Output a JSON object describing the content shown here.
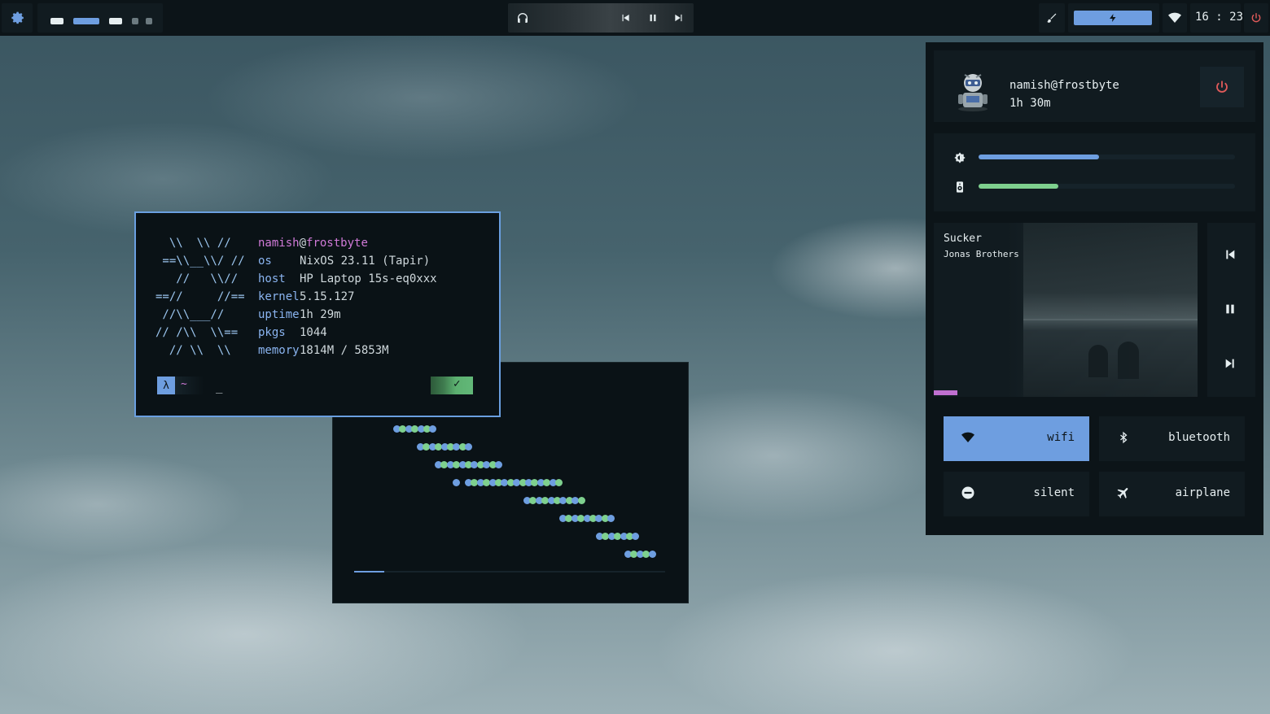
{
  "topbar": {
    "settings_icon": "gear-icon",
    "workspaces": [
      {
        "color": "#e6eef0",
        "active": false
      },
      {
        "color": "#6e9ee0",
        "active": true
      },
      {
        "color": "#e6eef0",
        "active": false
      },
      {
        "color": "#6c7a80",
        "active": false
      },
      {
        "color": "#6c7a80",
        "active": false
      }
    ],
    "media_icons": [
      "headphones-icon",
      "skip-previous-icon",
      "pause-icon",
      "skip-next-icon"
    ],
    "brush_icon": "brush-icon",
    "battery_icon": "lightning-icon",
    "wifi_icon": "wifi-icon",
    "clock": "16 : 23",
    "power_icon": "power-icon",
    "accent_color": "#6e9ee0",
    "danger_color": "#e05a5a"
  },
  "fetch": {
    "ascii_logo": "  \\\\  \\\\ //\n ==\\\\__\\\\/ //\n   //   \\\\//\n==//     //==\n //\\\\___//\n// /\\\\  \\\\==\n  // \\\\  \\\\",
    "user": "namish",
    "at": "@",
    "host": "frostbyte",
    "rows": [
      {
        "key": "os",
        "value": "NixOS 23.11 (Tapir)"
      },
      {
        "key": "host",
        "value": "HP Laptop 15s-eq0xxx"
      },
      {
        "key": "kernel",
        "value": "5.15.127"
      },
      {
        "key": "uptime",
        "value": "1h 29m"
      },
      {
        "key": "pkgs",
        "value": "1044"
      },
      {
        "key": "memory",
        "value": "1814M / 5853M"
      }
    ],
    "prompt_symbol": "λ",
    "prompt_dir": "~",
    "cursor": "_",
    "status_icon": "check-icon",
    "status_text": "✓"
  },
  "panel": {
    "username": "namish@frostbyte",
    "uptime": "1h 30m",
    "avatar_icon": "avatar-icon",
    "power_icon": "power-icon",
    "brightness": {
      "icon": "brightness-icon",
      "level": 0.47,
      "color": "#6e9ee0"
    },
    "volume": {
      "icon": "speaker-icon",
      "level": 0.31,
      "color": "#7ed08e"
    },
    "media": {
      "title": "Sucker",
      "artist": "Jonas Brothers",
      "progress": 0.09,
      "progress_color": "#c070d0",
      "prev_icon": "skip-previous-icon",
      "pause_icon": "pause-icon",
      "next_icon": "skip-next-icon"
    },
    "toggles": [
      {
        "label": "wifi",
        "icon": "wifi-icon",
        "active": true
      },
      {
        "label": "bluetooth",
        "icon": "bluetooth-icon",
        "active": false
      },
      {
        "label": "silent",
        "icon": "minus-circle-icon",
        "active": false
      },
      {
        "label": "airplane",
        "icon": "airplane-icon",
        "active": false
      }
    ]
  }
}
